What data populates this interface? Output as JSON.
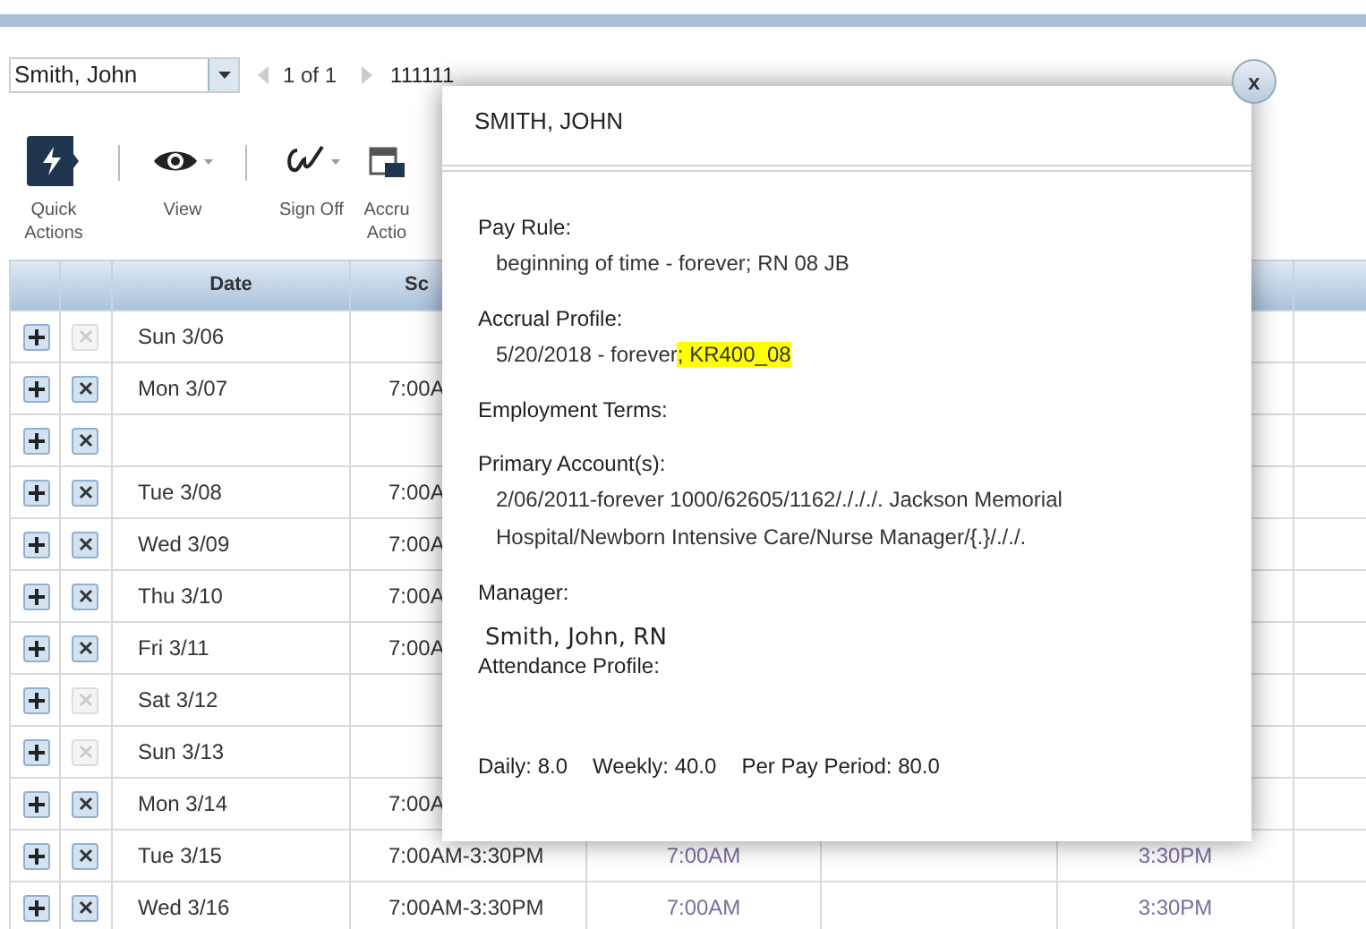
{
  "nav": {
    "employee": "Smith, John",
    "page": "1 of 1",
    "id": "111111"
  },
  "toolbar": [
    {
      "kind": "quick",
      "label": "Quick Actions"
    },
    {
      "kind": "view",
      "label": "View"
    },
    {
      "kind": "signoff",
      "label": "Sign Off"
    },
    {
      "kind": "accrual",
      "label": "Accru Actio"
    }
  ],
  "table": {
    "columns": [
      "Date",
      "Sc"
    ],
    "rows": [
      {
        "date": "Sun 3/06",
        "delete_enabled": false
      },
      {
        "date": "Mon 3/07",
        "delete_enabled": true,
        "shift": "7:00A"
      },
      {
        "delete_enabled": true
      },
      {
        "date": "Tue 3/08",
        "delete_enabled": true,
        "shift": "7:00A"
      },
      {
        "date": "Wed 3/09",
        "delete_enabled": true,
        "shift": "7:00A"
      },
      {
        "date": "Thu 3/10",
        "delete_enabled": true,
        "shift": "7:00A"
      },
      {
        "date": "Fri 3/11",
        "delete_enabled": true,
        "shift": "7:00A"
      },
      {
        "date": "Sat 3/12",
        "delete_enabled": false
      },
      {
        "date": "Sun 3/13",
        "delete_enabled": false
      },
      {
        "date": "Mon 3/14",
        "delete_enabled": true,
        "shift": "7:00A"
      },
      {
        "date": "Tue 3/15",
        "delete_enabled": true,
        "shift": "7:00AM-3:30PM",
        "in": "7:00AM",
        "out": "3:30PM"
      },
      {
        "date": "Wed 3/16",
        "delete_enabled": true,
        "shift": "7:00AM-3:30PM",
        "in": "7:00AM",
        "out": "3:30PM"
      }
    ]
  },
  "popup": {
    "title": "SMITH, JOHN",
    "close": "x",
    "sections": [
      {
        "label": "Pay Rule:",
        "lines": [
          {
            "text": "beginning of time - forever; RN 08 JB"
          }
        ]
      },
      {
        "label": "Accrual Profile:",
        "lines": [
          {
            "text": "5/20/2018 - forever",
            "highlight": "; KR400_08"
          }
        ]
      },
      {
        "label": "Employment Terms:"
      },
      {
        "label": "Primary Account(s):",
        "lines": [
          {
            "text": "2/06/2011-forever 1000/62605/1162/./././. Jackson Memorial"
          },
          {
            "text": "Hospital/Newborn Intensive Care/Nurse Manager/{.}/././."
          }
        ]
      },
      {
        "label": "Manager:"
      }
    ],
    "manager": "Smith, John, RN",
    "attendance_label": "Attendance Profile:",
    "totals": [
      "Daily: 8.0",
      "Weekly: 40.0",
      "Per Pay Period: 80.0"
    ]
  }
}
